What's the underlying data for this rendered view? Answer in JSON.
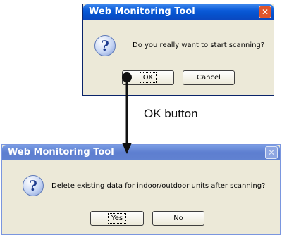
{
  "dialog1": {
    "title": "Web Monitoring Tool",
    "close_glyph": "✕",
    "icon": "question-icon",
    "icon_glyph": "?",
    "message": "Do you really want to start scanning?",
    "buttons": {
      "ok": "OK",
      "cancel": "Cancel"
    }
  },
  "dialog2": {
    "title": "Web Monitoring Tool",
    "close_glyph": "✕",
    "icon": "question-icon",
    "icon_glyph": "?",
    "message": "Delete existing data for indoor/outdoor units after scanning?",
    "buttons": {
      "yes": "Yes",
      "no": "No"
    }
  },
  "annotation": {
    "label": "OK button"
  }
}
